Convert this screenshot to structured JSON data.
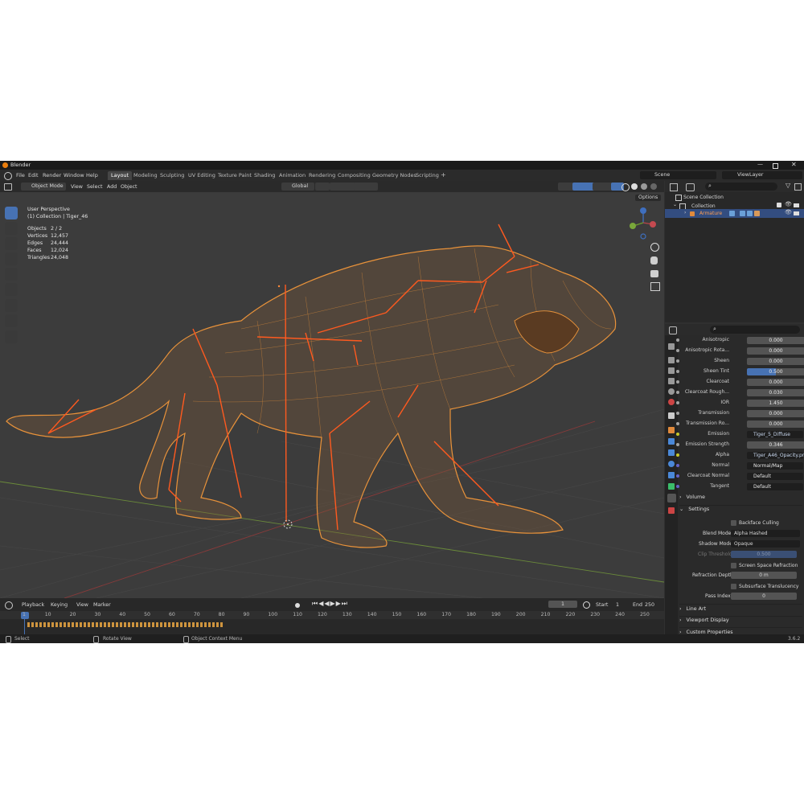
{
  "app": {
    "title": "Blender",
    "version": "3.6.2"
  },
  "menus": [
    "File",
    "Edit",
    "Render",
    "Window",
    "Help"
  ],
  "workspace_tabs": [
    "Layout",
    "Modeling",
    "Sculpting",
    "UV Editing",
    "Texture Paint",
    "Shading",
    "Animation",
    "Rendering",
    "Compositing",
    "Geometry Nodes",
    "Scripting"
  ],
  "active_tab": "Layout",
  "scene": {
    "name": "Scene",
    "view_layer": "ViewLayer"
  },
  "viewport_header": {
    "mode": "Object Mode",
    "menus": [
      "View",
      "Select",
      "Add",
      "Object"
    ],
    "orientation": "Global",
    "options": "Options"
  },
  "viewport_overlay": {
    "perspective": "User Perspective",
    "collection": "(1) Collection | Tiger_46",
    "stats": [
      {
        "label": "Objects",
        "value": "2 / 2"
      },
      {
        "label": "Vertices",
        "value": "12,457"
      },
      {
        "label": "Edges",
        "value": "24,444"
      },
      {
        "label": "Faces",
        "value": "12,024"
      },
      {
        "label": "Triangles",
        "value": "24,048"
      }
    ]
  },
  "outliner": {
    "root": "Scene Collection",
    "collection": "Collection",
    "item": "Armature"
  },
  "properties": {
    "rows": [
      {
        "label": "Anisotropic",
        "value": "0.000"
      },
      {
        "label": "Anisotropic Rota...",
        "value": "0.000"
      },
      {
        "label": "Sheen",
        "value": "0.000"
      },
      {
        "label": "Sheen Tint",
        "value": "0.500"
      },
      {
        "label": "Clearcoat",
        "value": "0.000"
      },
      {
        "label": "Clearcoat Rough...",
        "value": "0.030"
      },
      {
        "label": "IOR",
        "value": "1.450"
      },
      {
        "label": "Transmission",
        "value": "0.000"
      },
      {
        "label": "Transmission Ro...",
        "value": "0.000"
      },
      {
        "label": "Emission",
        "value": "Tiger_5_Diffuse"
      },
      {
        "label": "Emission Strength",
        "value": "0.346"
      },
      {
        "label": "Alpha",
        "value": "Tiger_A46_Opacity.png"
      },
      {
        "label": "Normal",
        "value": "Normal/Map"
      },
      {
        "label": "Clearcoat Normal",
        "value": "Default"
      },
      {
        "label": "Tangent",
        "value": "Default"
      }
    ],
    "volume": "Volume",
    "settings": "Settings",
    "backface_culling": "Backface Culling",
    "blend_mode_label": "Blend Mode",
    "blend_mode": "Alpha Hashed",
    "shadow_mode_label": "Shadow Mode",
    "shadow_mode": "Opaque",
    "clip_threshold_label": "Clip Threshold",
    "clip_threshold": "0.500",
    "ssr": "Screen Space Refraction",
    "refraction_depth_label": "Refraction Depth",
    "refraction_depth": "0 m",
    "subsurface": "Subsurface Translucency",
    "pass_index_label": "Pass Index",
    "pass_index": "0",
    "line_art": "Line Art",
    "viewport_display": "Viewport Display",
    "custom_properties": "Custom Properties"
  },
  "timeline": {
    "menus": [
      "Playback",
      "Keying",
      "View",
      "Marker"
    ],
    "current_frame": "1",
    "start_label": "Start",
    "start": "1",
    "end_label": "End",
    "end": "250",
    "ticks": [
      "1",
      "10",
      "20",
      "30",
      "40",
      "50",
      "60",
      "70",
      "80",
      "90",
      "100",
      "110",
      "120",
      "130",
      "140",
      "150",
      "160",
      "170",
      "180",
      "190",
      "200",
      "210",
      "220",
      "230",
      "240",
      "250"
    ]
  },
  "status_bar": {
    "select": "Select",
    "rotate": "Rotate View",
    "context": "Object Context Menu"
  },
  "colors": {
    "accent": "#4772b3",
    "wire": "#e8923a",
    "bone": "#ff5a1f",
    "grid_x": "#8a3a3a",
    "grid_y": "#6a8a3a"
  }
}
